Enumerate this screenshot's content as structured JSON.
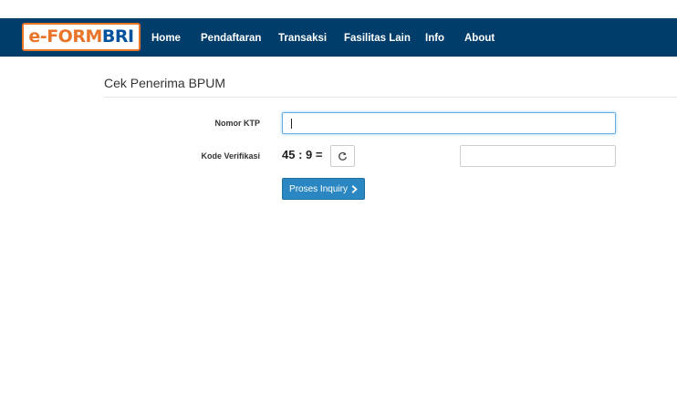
{
  "header": {
    "logo": {
      "prefix": "e-",
      "form": "FORM",
      "brand": "BRI"
    },
    "nav": [
      {
        "label": "Home"
      },
      {
        "label": "Pendaftaran"
      },
      {
        "label": "Transaksi"
      },
      {
        "label": "Fasilitas Lain"
      },
      {
        "label": "Info"
      },
      {
        "label": "About"
      }
    ]
  },
  "page": {
    "title": "Cek Penerima BPUM"
  },
  "form": {
    "nomor_ktp_label": "Nomor KTP",
    "nomor_ktp_value": "",
    "kode_verifikasi_label": "Kode Verifikasi",
    "captcha_question": "45 : 9 =",
    "captcha_answer_value": "",
    "submit_label": "Proses Inquiry"
  },
  "colors": {
    "navbar": "#003d6b",
    "primary_button": "#2a87c1",
    "logo_orange": "#e8742a",
    "logo_blue": "#00529c"
  },
  "icons": {
    "refresh": "refresh-icon",
    "submit": "chevron-right-icon"
  }
}
